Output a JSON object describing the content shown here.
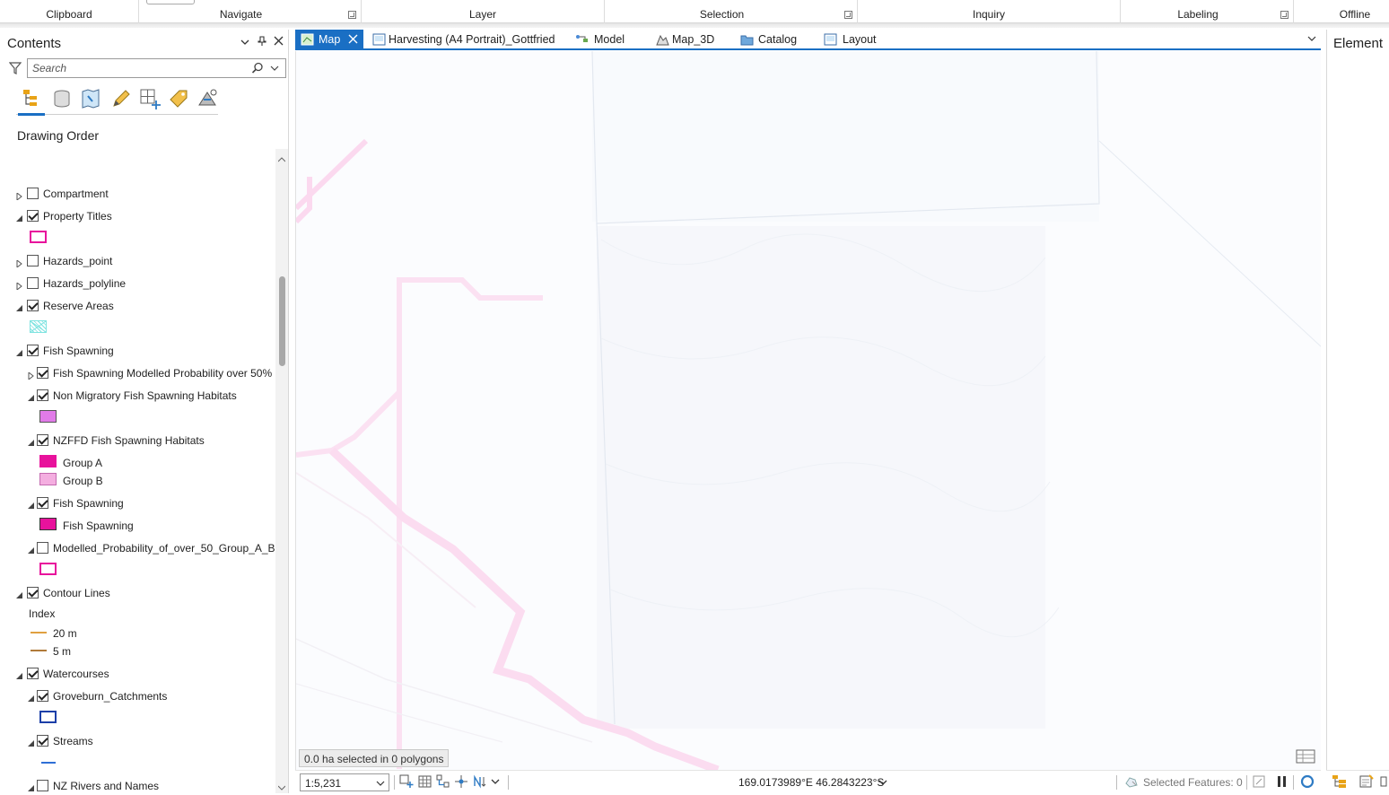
{
  "ribbon": {
    "groups": [
      {
        "label": "Clipboard"
      },
      {
        "label": "Navigate"
      },
      {
        "label": "Layer"
      },
      {
        "label": "Selection"
      },
      {
        "label": "Inquiry"
      },
      {
        "label": "Labeling"
      },
      {
        "label": "Offline"
      }
    ]
  },
  "contents": {
    "title": "Contents",
    "search_placeholder": "Search",
    "section_title": "Drawing Order",
    "layers": {
      "compartment": "Compartment",
      "property_titles": "Property Titles",
      "hazards_point": "Hazards_point",
      "hazards_polyline": "Hazards_polyline",
      "reserve_areas": "Reserve Areas",
      "fish_spawning_group": "Fish Spawning",
      "fish_spawning_modelled": "Fish Spawning Modelled Probability over 50%",
      "non_migratory": "Non Migratory Fish Spawning Habitats",
      "nzffd": "NZFFD Fish Spawning Habitats",
      "group_a": "Group A",
      "group_b": "Group B",
      "fish_spawning_layer": "Fish Spawning",
      "fish_spawning_legend": "Fish Spawning",
      "modelled_prob": "Modelled_Probability_of_over_50_Group_A_B",
      "contour_lines": "Contour Lines",
      "index_heading": "Index",
      "contour_20m": "20 m",
      "contour_5m": "5 m",
      "watercourses": "Watercourses",
      "groveburn": "Groveburn_Catchments",
      "streams": "Streams",
      "nz_rivers": "NZ Rivers and Names"
    },
    "colors": {
      "magenta": "#e8129c",
      "pink_light": "#f4aee0",
      "purple_fill": "#e17be8",
      "cyan_hatch": "#7fe3e0",
      "contour_orange": "#e0a040",
      "contour_brown": "#b07a3a",
      "stream_blue": "#2f6fd6",
      "catchment_blue": "#1c3fa8"
    }
  },
  "tabs": [
    {
      "label": "Map",
      "active": true
    },
    {
      "label": "Harvesting (A4 Portrait)_Gottfried"
    },
    {
      "label": "Model"
    },
    {
      "label": "Map_3D"
    },
    {
      "label": "Catalog"
    },
    {
      "label": "Layout"
    }
  ],
  "map": {
    "selection_summary": "0.0 ha selected in 0 polygons"
  },
  "status": {
    "scale": "1:5,231",
    "coordinates": "169.0173989°E 46.2843223°S",
    "selected_features": "Selected Features: 0"
  },
  "element_pane": {
    "title": "Element"
  }
}
